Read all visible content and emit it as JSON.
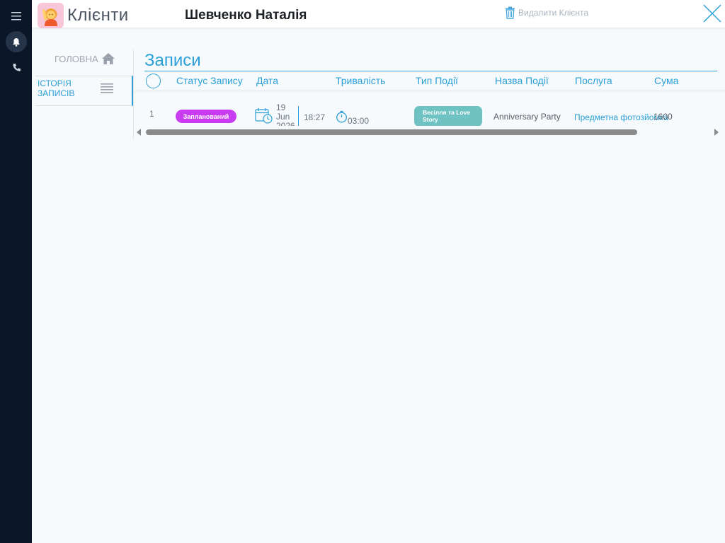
{
  "header": {
    "app_title": "Клієнти",
    "client_name": "Шевченко Наталія",
    "delete_label": "Видалити Клієнта"
  },
  "subnav": {
    "home_label": "ГОЛОВНА",
    "history_label": "ІСТОРІЯ ЗАПИСІВ"
  },
  "section": {
    "title": "Записи"
  },
  "table": {
    "columns": [
      "Статус Запису",
      "Дата",
      "Тривалість",
      "Тип Події",
      "Назва Події",
      "Послуга",
      "Сума"
    ],
    "rows": [
      {
        "num": "1",
        "status": "Запланований",
        "date_day": "19",
        "date_month": "Jun",
        "date_year": "2026",
        "time": "18:27",
        "duration": "03:00",
        "event_type": "Весілля та Love Story",
        "event_name": "Anniversary Party",
        "service": "Предметна фотозйомка",
        "amount": "1600"
      }
    ]
  },
  "colors": {
    "accent": "#2a9fd8",
    "status_planned": "#c73cf0",
    "event_type": "#6fc2c2",
    "rail": "#0b1729"
  },
  "icons": [
    "menu-icon",
    "bell-icon",
    "phone-icon",
    "trash-icon",
    "close-icon",
    "home-icon",
    "list-icon",
    "calendar-icon",
    "timer-icon"
  ]
}
